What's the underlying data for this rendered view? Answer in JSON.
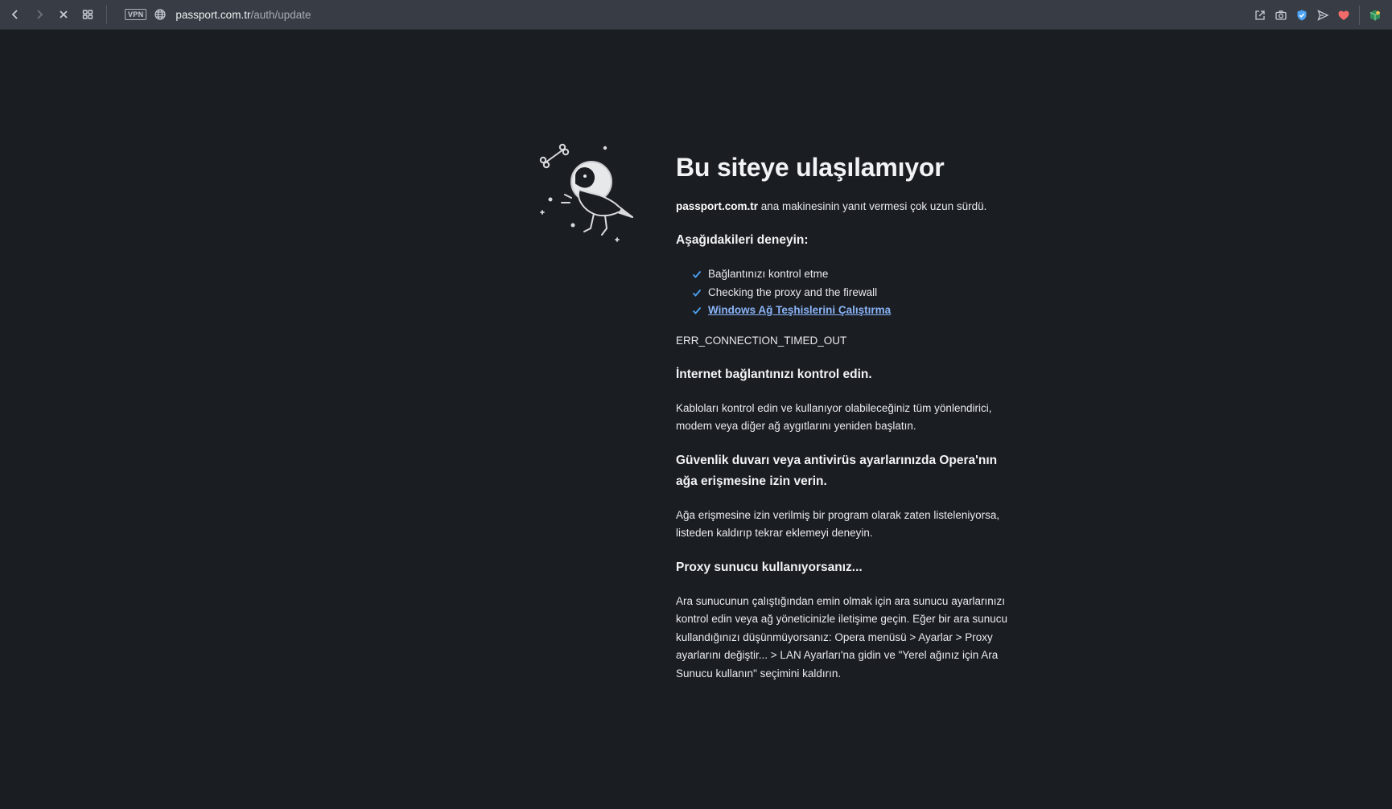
{
  "browser": {
    "url_host": "passport.com.tr",
    "url_path": "/auth/update",
    "vpn_label": "VPN"
  },
  "error_page": {
    "title": "Bu siteye ulaşılamıyor",
    "lead_host": "passport.com.tr",
    "lead_rest": " ana makinesinin yanıt vermesi çok uzun sürdü.",
    "try_heading": "Aşağıdakileri deneyin:",
    "suggestions": [
      "Bağlantınızı kontrol etme",
      "Checking the proxy and the firewall"
    ],
    "diagnostics_link": "Windows Ağ Teşhislerini Çalıştırma",
    "error_code": "ERR_CONNECTION_TIMED_OUT",
    "sections": [
      {
        "heading": "İnternet bağlantınızı kontrol edin.",
        "body": "Kabloları kontrol edin ve kullanıyor olabileceğiniz tüm yönlendirici, modem veya diğer ağ aygıtlarını yeniden başlatın."
      },
      {
        "heading": "Güvenlik duvarı veya antivirüs ayarlarınızda Opera'nın ağa erişmesine izin verin.",
        "body": "Ağa erişmesine izin verilmiş bir program olarak zaten listeleniyorsa, listeden kaldırıp tekrar eklemeyi deneyin."
      },
      {
        "heading": "Proxy sunucu kullanıyorsanız...",
        "body": "Ara sunucunun çalıştığından emin olmak için ara sunucu ayarlarınızı kontrol edin veya ağ yöneticinizle iletişime geçin. Eğer bir ara sunucu kullandığınızı düşünmüyorsanız: Opera menüsü > Ayarlar > Proxy ayarlarını değiştir... > LAN Ayarları'na gidin ve \"Yerel ağınız için Ara Sunucu kullanın\" seçimini kaldırın."
      }
    ]
  },
  "colors": {
    "page_bg": "#1a1d22",
    "toolbar_bg": "#383d45",
    "link": "#8ab4f8",
    "check": "#4da3f5",
    "heart": "#f26b6b",
    "shield": "#4da3f5"
  },
  "icons": {
    "back": "arrow-left-icon",
    "forward": "arrow-right-icon",
    "stop": "close-icon",
    "tabs": "grid-icon",
    "globe": "globe-icon",
    "share": "share-icon",
    "snapshot": "camera-icon",
    "adblock": "shield-icon",
    "send": "send-icon",
    "favorite": "heart-icon",
    "extension": "cube-icon"
  }
}
